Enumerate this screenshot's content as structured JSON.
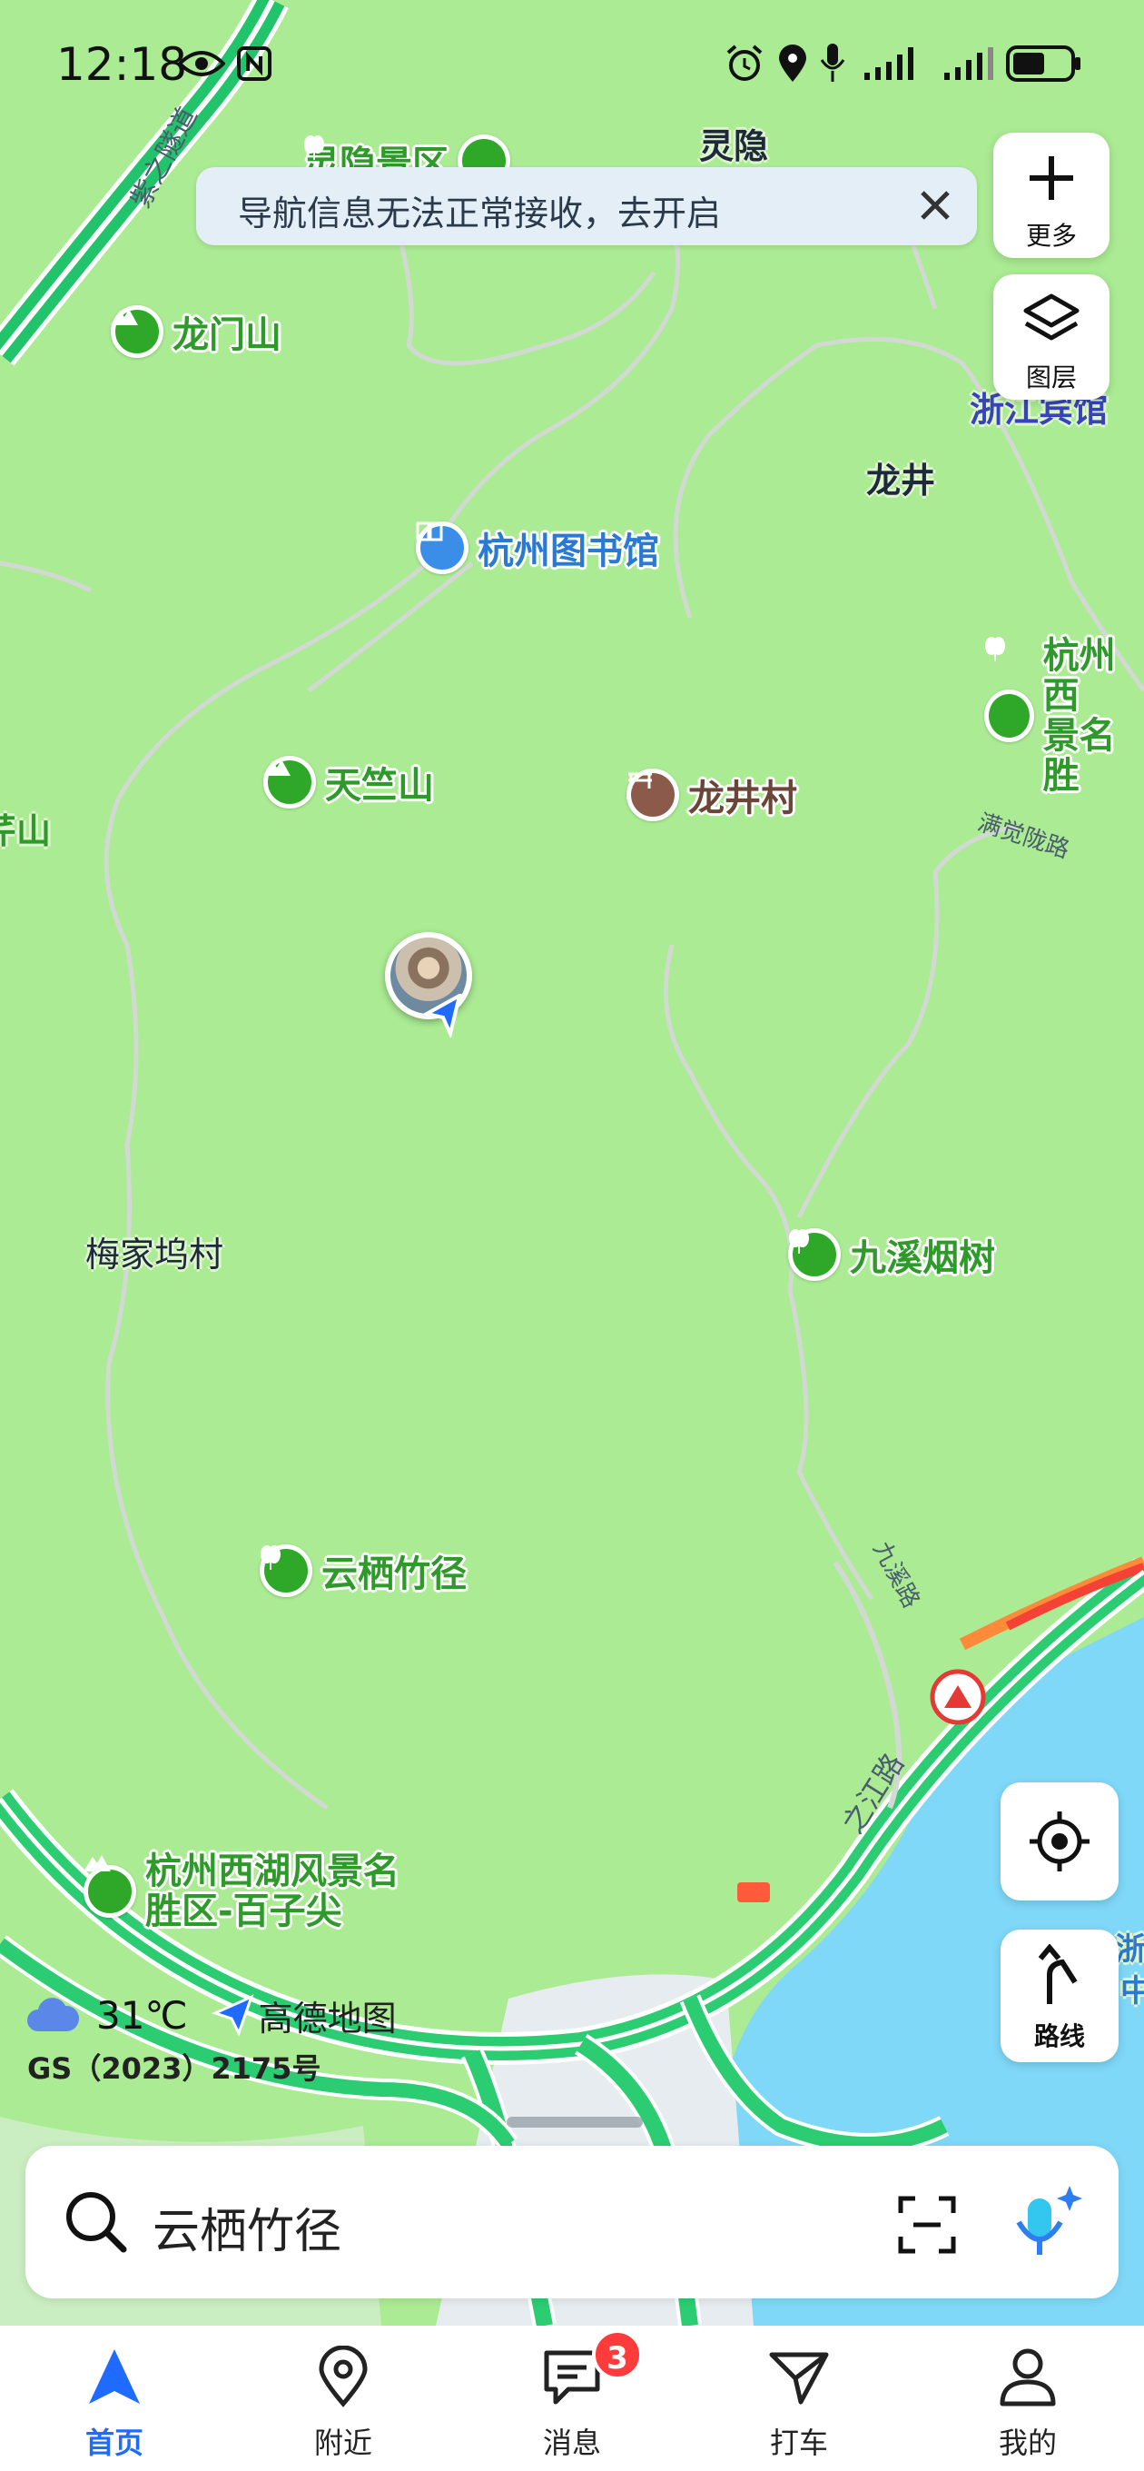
{
  "status_bar": {
    "time": "12:18",
    "icons": [
      "eye-icon",
      "nfc-icon",
      "alarm-icon",
      "location-icon",
      "mic-icon",
      "signal-icon",
      "signal-icon",
      "battery-icon"
    ]
  },
  "banner": {
    "text": "导航信息无法正常接收，去开启",
    "close_icon": "close-icon"
  },
  "map_controls": {
    "more_label": "更多",
    "layers_label": "图层",
    "route_label": "路线"
  },
  "pois": {
    "longmenshan": "龙门山",
    "lingyin_scenic": "灵隐景区",
    "library": "杭州图书馆",
    "tianzhushan": "天竺山",
    "longjing_village": "龙井村",
    "jiuxi": "九溪烟树",
    "yunqi": "云栖竹径",
    "baizijian_line1": "杭州西湖风景名",
    "baizijian_line2": "胜区-百子尖",
    "xihu_partial_line1": "杭州西",
    "xihu_partial_line2": "景名胜"
  },
  "places": {
    "lingyin": "灵隐",
    "longjing": "龙井",
    "meijiawu": "梅家坞村",
    "zhejiang_hotel": "浙江宾馆",
    "partial_shan": "芹山",
    "partial_right": "浙",
    "partial_right2": "中"
  },
  "roads": {
    "manjuelong": "满觉陇路",
    "jiuxi_road": "九溪路",
    "zhijiang_road": "之江路",
    "zijing_tunnel": "紫之隧道"
  },
  "weather": {
    "temperature": "31℃",
    "brand": "高德地图"
  },
  "attribution": "GS（2023）2175号",
  "search": {
    "text": "云栖竹径"
  },
  "bottom_nav": {
    "items": [
      {
        "label": "首页",
        "icon": "navigation-arrow-icon",
        "active": true
      },
      {
        "label": "附近",
        "icon": "map-pin-icon",
        "active": false
      },
      {
        "label": "消息",
        "icon": "message-icon",
        "active": false
      },
      {
        "label": "打车",
        "icon": "taxi-icon",
        "active": false
      },
      {
        "label": "我的",
        "icon": "user-icon",
        "active": false
      }
    ],
    "message_badge": "3"
  },
  "colors": {
    "map_green": "#abeb93",
    "water": "#7fd8f8",
    "accent_blue": "#1f6bff",
    "poi_green": "#2fa82a",
    "poi_blue": "#3a8ee8",
    "poi_brown": "#8c5a4a",
    "badge_red": "#ff3b3b"
  }
}
